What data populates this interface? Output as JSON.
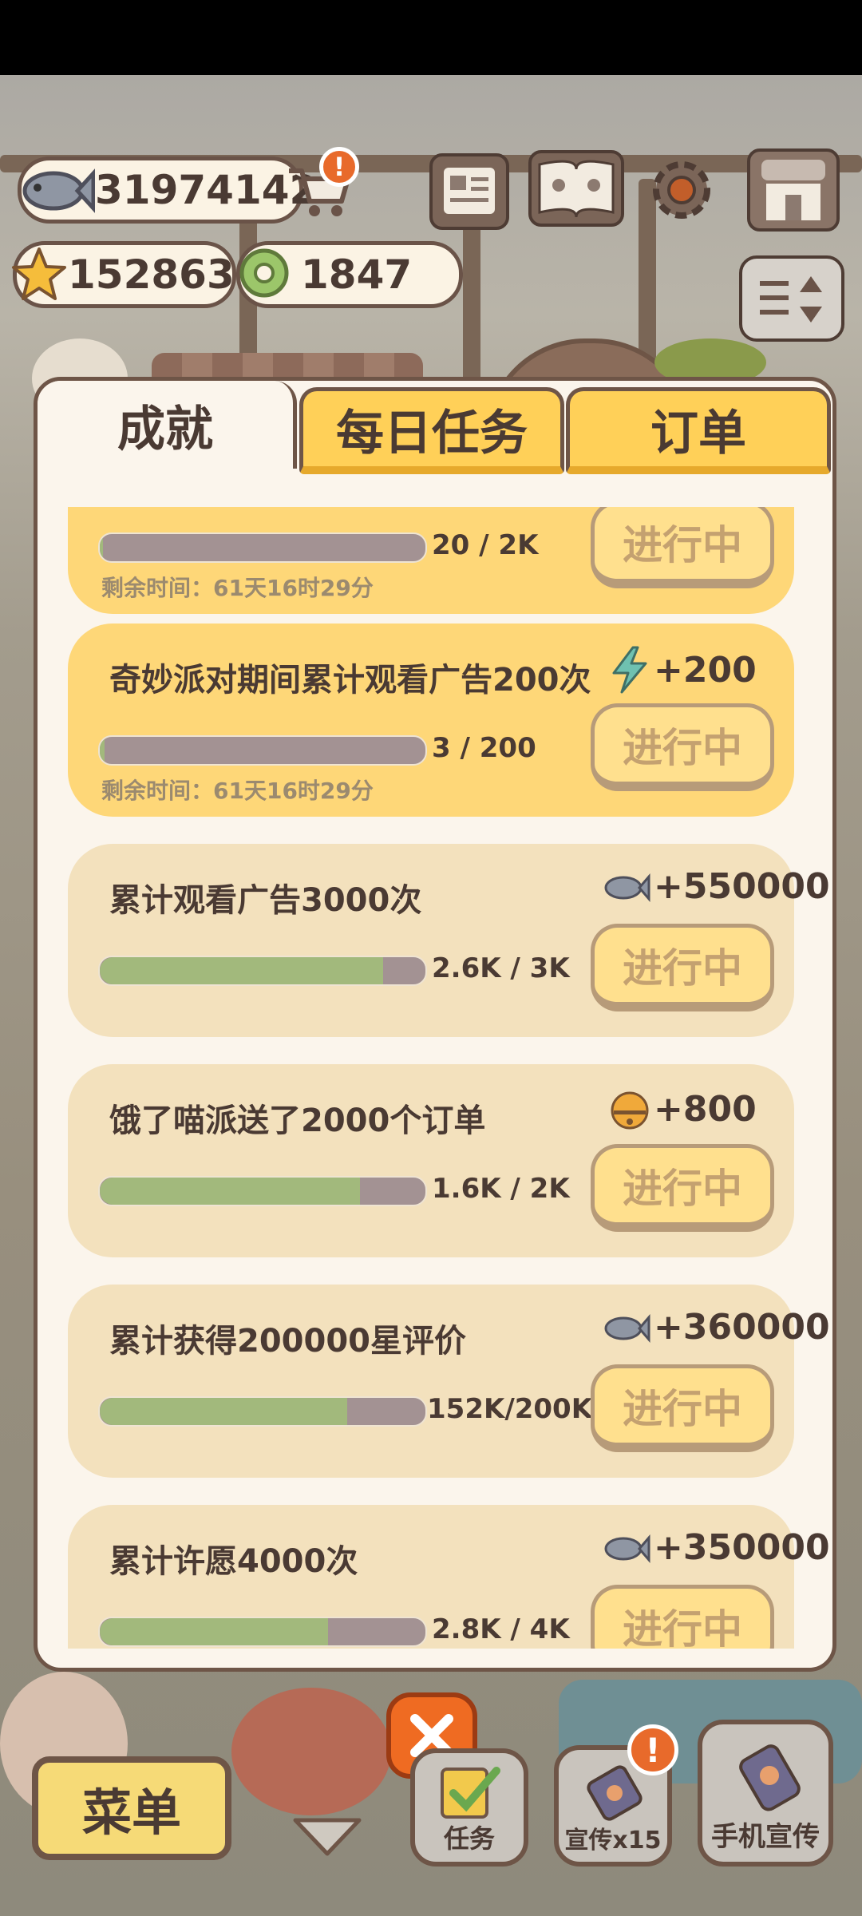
{
  "currencies": {
    "fish": "31974142",
    "stars": "152863.",
    "gems": "1847"
  },
  "tabs": [
    {
      "label": "成就"
    },
    {
      "label": "每日任务"
    },
    {
      "label": "订单"
    }
  ],
  "achievements": [
    {
      "title": "",
      "reward_icon": "none",
      "reward": "",
      "progress_text": "20  /  2K",
      "progress": 0.01,
      "remaining": "剩余时间：61天16时29分",
      "status": "进行中",
      "highlight": true
    },
    {
      "title": "奇妙派对期间累计观看广告200次",
      "reward_icon": "lightning-icon",
      "reward": "+200",
      "progress_text": "3   / 200",
      "progress": 0.015,
      "remaining": "剩余时间：61天16时29分",
      "status": "进行中",
      "highlight": true
    },
    {
      "title": "累计观看广告3000次",
      "reward_icon": "fish-icon",
      "reward": "+550000",
      "progress_text": "2.6K /  3K",
      "progress": 0.87,
      "remaining": "",
      "status": "进行中",
      "highlight": false
    },
    {
      "title": "饿了喵派送了2000个订单",
      "reward_icon": "bell-icon",
      "reward": "+800",
      "progress_text": "1.6K /  2K",
      "progress": 0.8,
      "remaining": "",
      "status": "进行中",
      "highlight": false
    },
    {
      "title": "累计获得200000星评价",
      "reward_icon": "fish-icon",
      "reward": "+360000",
      "progress_text": "152K/200K",
      "progress": 0.76,
      "remaining": "",
      "status": "进行中",
      "highlight": false
    },
    {
      "title": "累计许愿4000次",
      "reward_icon": "fish-icon",
      "reward": "+350000",
      "progress_text": "2.8K /  4K",
      "progress": 0.7,
      "remaining": "",
      "status": "进行中",
      "highlight": false
    }
  ],
  "bottom_nav": {
    "menu": "菜单",
    "task": "任务",
    "promote": "宣传x15",
    "phone_promote": "手机宣传"
  },
  "colors": {
    "accent": "#ffd058",
    "highlight_card": "#fed778",
    "card": "#f3e1bd",
    "progress_fill": "#a2b97c",
    "progress_track": "#a39293",
    "close_button": "#ef6b22"
  }
}
